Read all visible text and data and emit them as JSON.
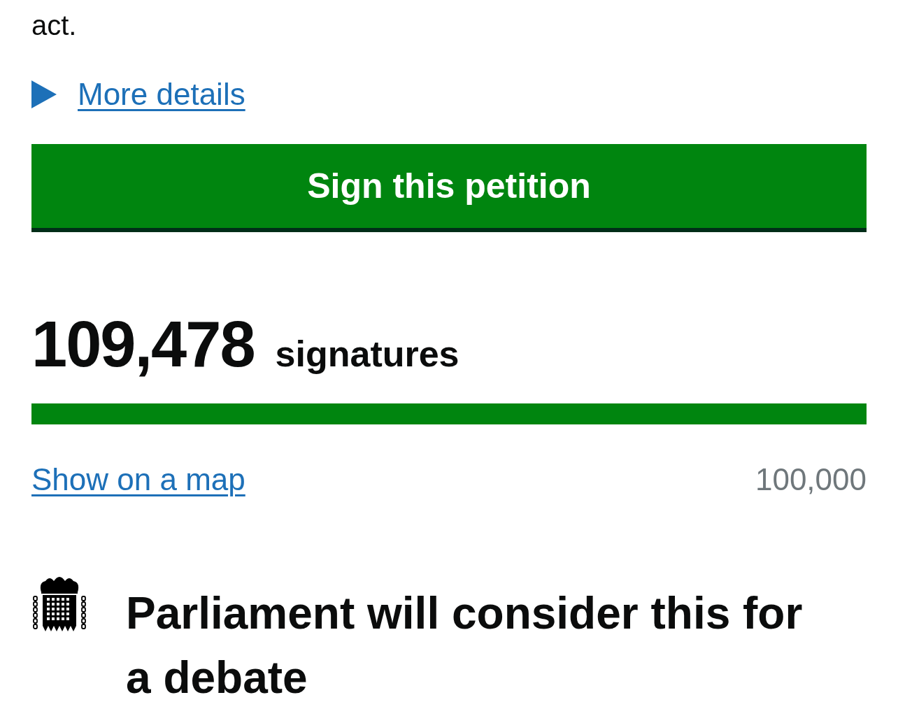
{
  "intro_tail": "act.",
  "details": {
    "label": "More details",
    "expanded": false
  },
  "sign_button": "Sign this petition",
  "signatures": {
    "count": "109,478",
    "label": "signatures",
    "level": 1
  },
  "map_link": "Show on a map",
  "target": "100,000",
  "debate": "Parliament will consider this for a debate"
}
